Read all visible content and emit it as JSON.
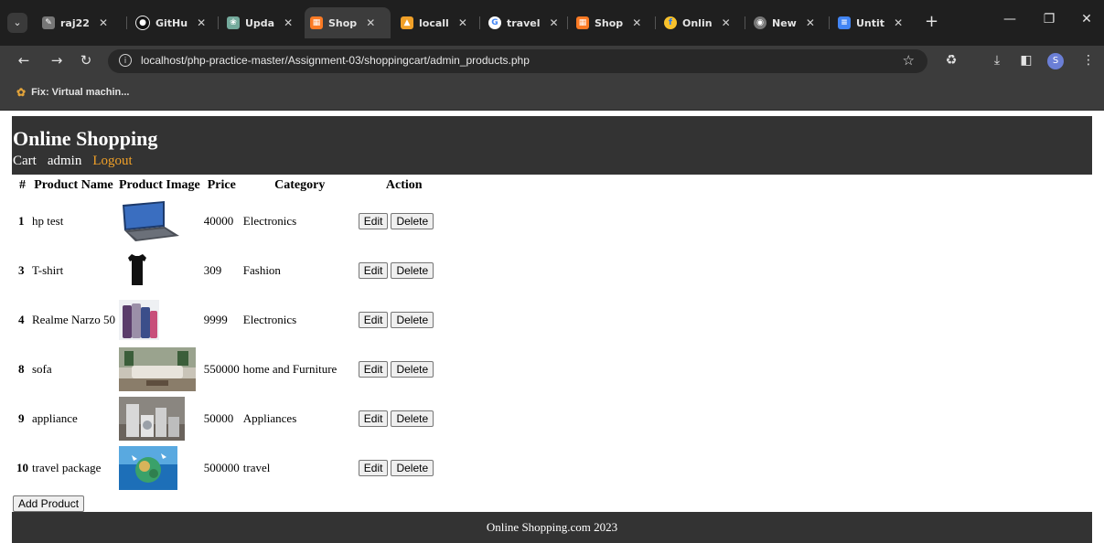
{
  "browser": {
    "tabs": [
      {
        "label": "raj22",
        "icon": "edit-icon",
        "color": "#cccccc"
      },
      {
        "label": "GitHu",
        "icon": "github-icon",
        "color": "#ffffff"
      },
      {
        "label": "Upda",
        "icon": "chatgpt-icon",
        "color": "#74aa9c"
      },
      {
        "label": "Shop",
        "icon": "xampp-icon",
        "color": "#fb7a24",
        "active": true
      },
      {
        "label": "locall",
        "icon": "phpmyadmin-icon",
        "color": "#f0a028"
      },
      {
        "label": "travel",
        "icon": "google-icon",
        "color": "#4285f4"
      },
      {
        "label": "Shop",
        "icon": "xampp-icon",
        "color": "#fb7a24"
      },
      {
        "label": "Onlin",
        "icon": "flipkart-icon",
        "color": "#f7c12d"
      },
      {
        "label": "New",
        "icon": "chrome-icon",
        "color": "#aaaaaa"
      },
      {
        "label": "Untit",
        "icon": "docs-icon",
        "color": "#4285f4"
      }
    ],
    "url": "localhost/php-practice-master/Assignment-03/shoppingcart/admin_products.php",
    "bookmark": "Fix: Virtual machin...",
    "profile_initial": "S"
  },
  "site": {
    "title": "Online Shopping",
    "nav": {
      "cart": "Cart",
      "user": "admin",
      "logout": "Logout"
    },
    "footer": "Online Shopping.com 2023",
    "add_product_label": "Add Product"
  },
  "table": {
    "headers": [
      "#",
      "Product Name",
      "Product Image",
      "Price",
      "Category",
      "Action"
    ],
    "edit_label": "Edit",
    "delete_label": "Delete",
    "rows": [
      {
        "id": "1",
        "name": "hp test",
        "image": "laptop-image",
        "price": "40000",
        "category": "Electronics"
      },
      {
        "id": "3",
        "name": "T-shirt",
        "image": "tshirt-image",
        "price": "309",
        "category": "Fashion"
      },
      {
        "id": "4",
        "name": "Realme Narzo 50",
        "image": "phones-image",
        "price": "9999",
        "category": "Electronics"
      },
      {
        "id": "8",
        "name": "sofa",
        "image": "sofa-room-image",
        "price": "550000",
        "category": "home and Furniture"
      },
      {
        "id": "9",
        "name": "appliance",
        "image": "appliances-image",
        "price": "50000",
        "category": "Appliances"
      },
      {
        "id": "10",
        "name": "travel package",
        "image": "travel-globe-image",
        "price": "500000",
        "category": "travel"
      }
    ]
  },
  "colors": {
    "header_bg": "#333333",
    "logout": "#f0a028",
    "chrome_dark": "#1f1f1f"
  }
}
